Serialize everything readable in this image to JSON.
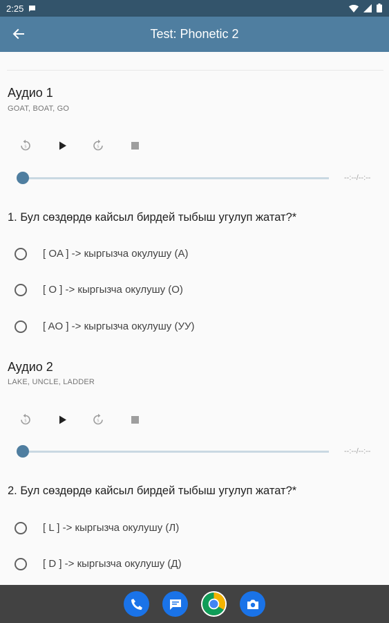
{
  "status_bar": {
    "time": "2:25"
  },
  "app_bar": {
    "title": "Test: Phonetic 2"
  },
  "audio_1": {
    "title": "Аудио 1",
    "words": "GOAT, BOAT, GO",
    "time": "--:--/--:--",
    "progress": 0
  },
  "question_1": {
    "text": "1. Бул сөздөрдө кайсыл бирдей тыбыш угулуп жатат?*",
    "options": [
      "[ OA ] -> кыргызча окулушу (А)",
      "[ O ] -> кыргызча окулушу (О)",
      "[ AO ] -> кыргызча окулушу (УУ)"
    ]
  },
  "audio_2": {
    "title": "Аудио 2",
    "words": "LAKE, UNCLE, LADDER",
    "time": "--:--/--:--",
    "progress": 0
  },
  "question_2": {
    "text": "2. Бул сөздөрдө кайсыл бирдей тыбыш угулуп жатат?*",
    "options": [
      "[ L ] -> кыргызча окулушу (Л)",
      "[ D ] -> кыргызча окулушу (Д)"
    ]
  },
  "dock": [
    "phone-icon",
    "messages-icon",
    "chrome-icon",
    "camera-icon"
  ],
  "colors": {
    "app_bar": "#4f7ea0",
    "status_bar": "#33546b",
    "accent": "#4f7ea0"
  }
}
